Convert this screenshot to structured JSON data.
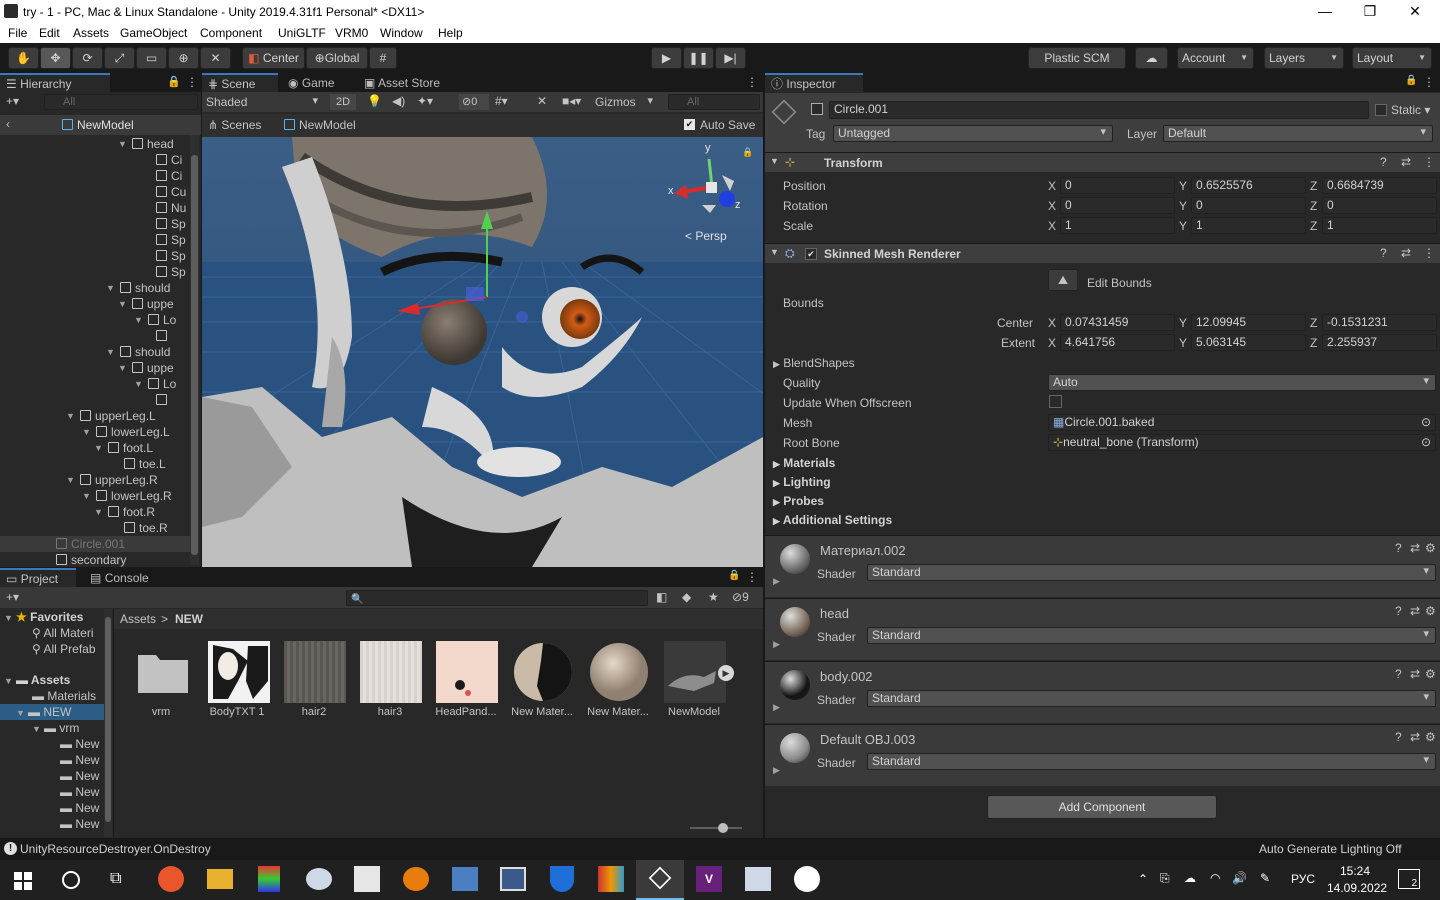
{
  "window": {
    "title": "try - 1 - PC, Mac & Linux Standalone - Unity 2019.4.31f1 Personal* <DX11>",
    "min": "—",
    "max": "❐",
    "close": "✕"
  },
  "menu": [
    "File",
    "Edit",
    "Assets",
    "GameObject",
    "Component",
    "UniGLTF",
    "VRM0",
    "Window",
    "Help"
  ],
  "toolbar": {
    "center": "Center",
    "global": "Global",
    "plastic": "Plastic SCM",
    "account": "Account",
    "layers": "Layers",
    "layout": "Layout"
  },
  "hierarchy": {
    "tab": "Hierarchy",
    "search": "All",
    "root": "NewModel",
    "items": [
      "head",
      "Ci",
      "Ci",
      "Cu",
      "Nu",
      "Sp",
      "Sp",
      "Sp",
      "Sp",
      "should",
      "uppe",
      "Lo",
      "",
      "should",
      "uppe",
      "Lo",
      "",
      "upperLeg.L",
      "lowerLeg.L",
      "foot.L",
      "toe.L",
      "upperLeg.R",
      "lowerLeg.R",
      "foot.R",
      "toe.R",
      "Circle.001",
      "secondary"
    ]
  },
  "scene": {
    "tabs": [
      "Scene",
      "Game",
      "Asset Store"
    ],
    "shading": "Shaded",
    "mode2d": "2D",
    "hidden_count": "0",
    "gizmos": "Gizmos",
    "search": "All",
    "crumb1": "Scenes",
    "crumb2": "NewModel",
    "autosave": "Auto Save",
    "persp": "Persp",
    "axis_x": "x",
    "axis_y": "y",
    "axis_z": "z"
  },
  "project": {
    "tabs": [
      "Project",
      "Console"
    ],
    "count": "9",
    "favorites": "Favorites",
    "fav_items": [
      "All Materi",
      "All Prefab"
    ],
    "assets": "Assets",
    "tree": [
      "Materials",
      "NEW",
      "vrm",
      "New",
      "New",
      "New",
      "New",
      "New",
      "New"
    ],
    "crumb": [
      "Assets",
      "NEW"
    ],
    "files": [
      "vrm",
      "BodyTXT 1",
      "hair2",
      "hair3",
      "HeadPand...",
      "New Mater...",
      "New Mater...",
      "NewModel"
    ]
  },
  "inspector": {
    "tab": "Inspector",
    "name": "Circle.001",
    "static": "Static",
    "tag_label": "Tag",
    "tag": "Untagged",
    "layer_label": "Layer",
    "layer": "Default",
    "transform": {
      "title": "Transform",
      "position": [
        "0",
        "0.6525576",
        "0.6684739"
      ],
      "rotation": [
        "0",
        "0",
        "0"
      ],
      "scale": [
        "1",
        "1",
        "1"
      ],
      "labels": [
        "Position",
        "Rotation",
        "Scale"
      ]
    },
    "smr": {
      "title": "Skinned Mesh Renderer",
      "edit_bounds": "Edit Bounds",
      "bounds": "Bounds",
      "center_label": "Center",
      "center": [
        "0.07431459",
        "12.09945",
        "-0.1531231"
      ],
      "extent_label": "Extent",
      "extent": [
        "4.641756",
        "5.063145",
        "2.255937"
      ],
      "blendshapes": "BlendShapes",
      "quality_label": "Quality",
      "quality": "Auto",
      "update_label": "Update When Offscreen",
      "mesh_label": "Mesh",
      "mesh": "Circle.001.baked",
      "rootbone_label": "Root Bone",
      "rootbone": "neutral_bone (Transform)",
      "sections": [
        "Materials",
        "Lighting",
        "Probes",
        "Additional Settings"
      ]
    },
    "materials": [
      {
        "name": "Материал.002",
        "shader": "Standard",
        "color": "#6b6b6b"
      },
      {
        "name": "head",
        "shader": "Standard",
        "color": "#7a6a5c"
      },
      {
        "name": "body.002",
        "shader": "Standard",
        "color": "#141414"
      },
      {
        "name": "Default OBJ.003",
        "shader": "Standard",
        "color": "#8a8a8a"
      }
    ],
    "shader_label": "Shader",
    "add_component": "Add Component",
    "xyz": [
      "X",
      "Y",
      "Z"
    ]
  },
  "status": {
    "message": "UnityResourceDestroyer.OnDestroy",
    "lighting": "Auto Generate Lighting Off"
  },
  "taskbar": {
    "lang": "РУС",
    "time": "15:24",
    "date": "14.09.2022",
    "notif": "2"
  }
}
